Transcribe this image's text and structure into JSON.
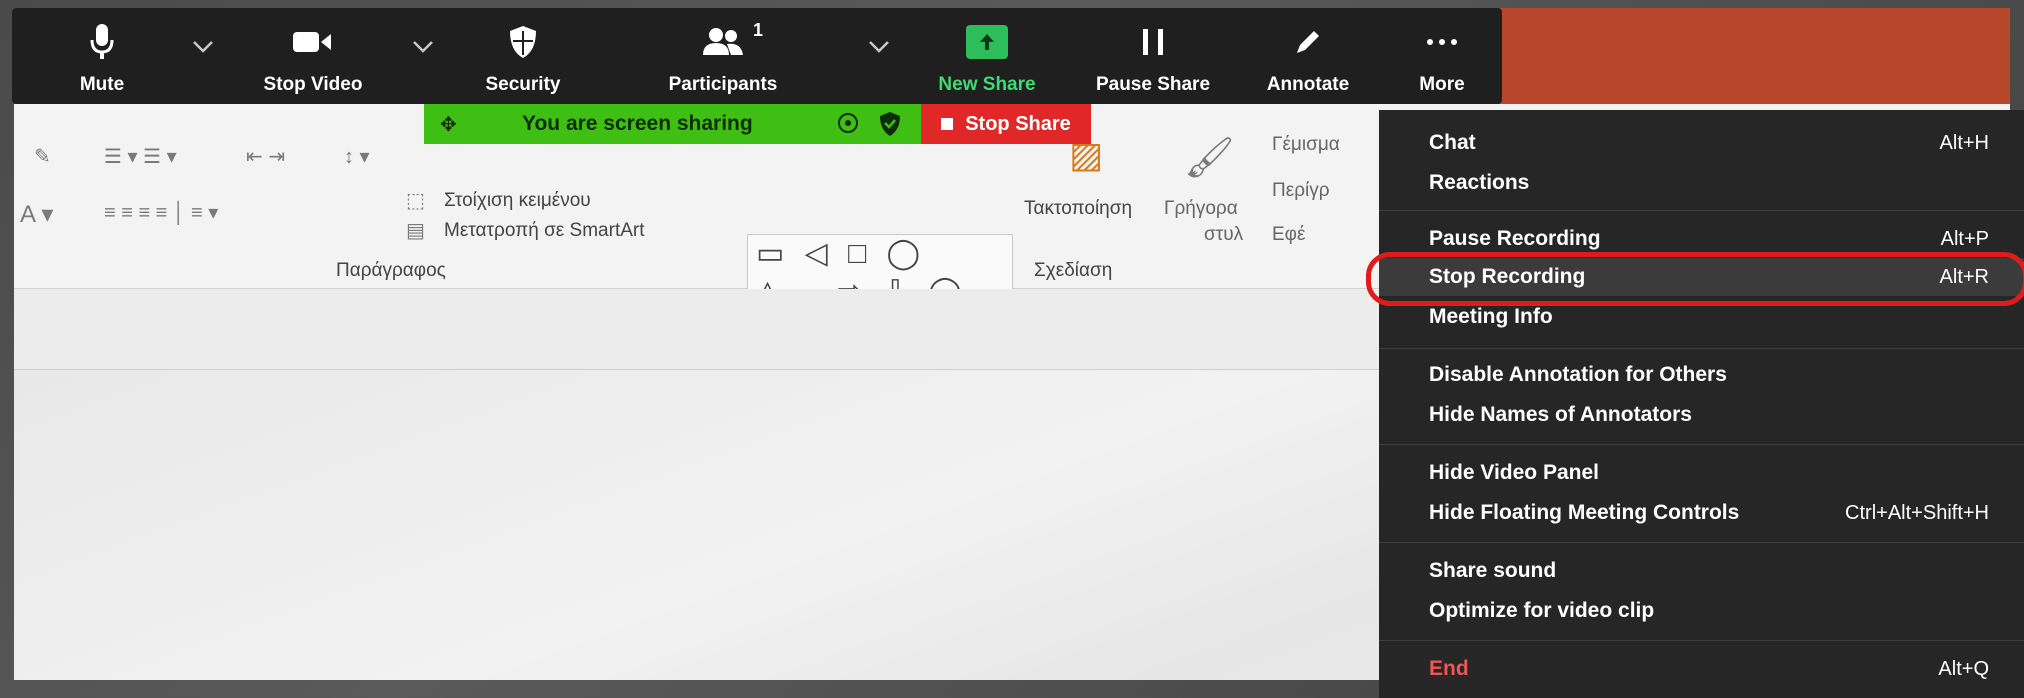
{
  "toolbar": {
    "mute": "Mute",
    "stop_video": "Stop Video",
    "security": "Security",
    "participants": "Participants",
    "participants_count": "1",
    "new_share": "New Share",
    "pause_share": "Pause Share",
    "annotate": "Annotate",
    "more": "More"
  },
  "banner": {
    "text": "You are screen sharing",
    "stop_share": "Stop Share"
  },
  "ribbon": {
    "text_align": "Στοίχιση κειμένου",
    "smartart": "Μετατροπή σε SmartArt",
    "arrange": "Τακτοποίηση",
    "quick_styles_1": "Γρήγορα",
    "quick_styles_2": "στυλ",
    "fill": "Γέμισμα",
    "outline": "Περίγρ",
    "effects": "Εφέ",
    "paragraph_group": "Παράγραφος",
    "drawing_group": "Σχεδίαση"
  },
  "menu": {
    "items": [
      {
        "label": "Chat",
        "shortcut": "Alt+H"
      },
      {
        "label": "Reactions",
        "shortcut": ""
      },
      {
        "label": "Pause Recording",
        "shortcut": "Alt+P"
      },
      {
        "label": "Stop Recording",
        "shortcut": "Alt+R"
      },
      {
        "label": "Meeting Info",
        "shortcut": ""
      },
      {
        "label": "Disable Annotation for Others",
        "shortcut": ""
      },
      {
        "label": "Hide Names of Annotators",
        "shortcut": ""
      },
      {
        "label": "Hide Video Panel",
        "shortcut": ""
      },
      {
        "label": "Hide Floating Meeting Controls",
        "shortcut": "Ctrl+Alt+Shift+H"
      },
      {
        "label": "Share sound",
        "shortcut": ""
      },
      {
        "label": "Optimize for video clip",
        "shortcut": ""
      },
      {
        "label": "End",
        "shortcut": "Alt+Q"
      }
    ]
  },
  "colors": {
    "toolbar_bg": "#1f1f1f",
    "share_green": "#2dbd5b",
    "banner_green": "#3fbf14",
    "stop_red": "#e02828",
    "end_red": "#f05454",
    "highlight_ring": "#e01b1b",
    "titlebar": "#b7472a"
  },
  "icons": [
    "microphone-icon",
    "video-camera-icon",
    "shield-icon",
    "participants-icon",
    "share-arrow-icon",
    "pause-icon",
    "pencil-icon",
    "ellipsis-icon",
    "chevron-down-icon"
  ]
}
